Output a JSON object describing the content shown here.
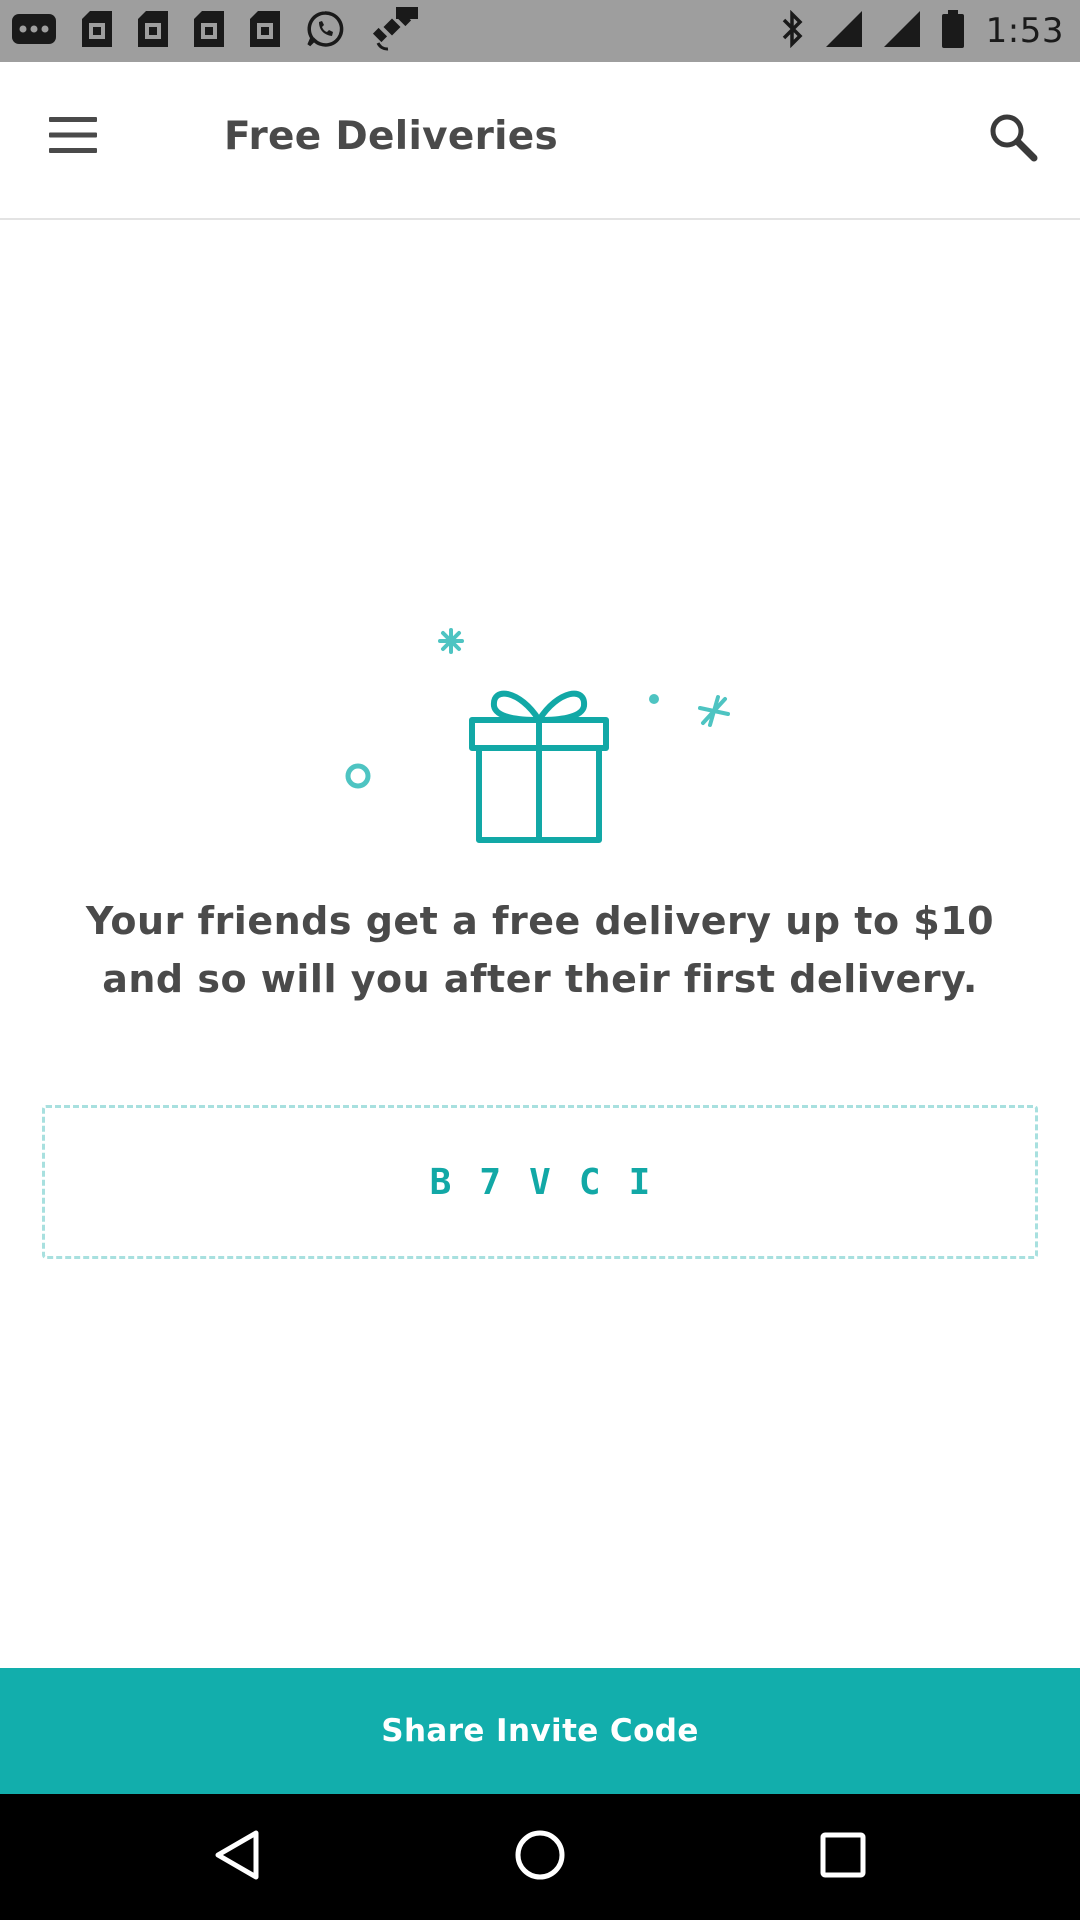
{
  "status_bar": {
    "time": "1:53",
    "left_icons": [
      "more-dots-icon",
      "sim-card-icon",
      "sim-card-icon",
      "sim-card-icon",
      "sim-card-icon",
      "whatsapp-icon",
      "satellite-fake-gps-icon"
    ],
    "right_icons": [
      "bluetooth-icon",
      "signal-icon",
      "signal-icon",
      "battery-icon"
    ]
  },
  "app_bar": {
    "title": "Free Deliveries",
    "menu_icon": "hamburger-menu-icon",
    "search_icon": "search-icon"
  },
  "illustration": {
    "icon": "gift-box-icon",
    "color": "#12a8a6"
  },
  "main": {
    "message": "Your friends get a free delivery up to $10 and so will you after their first delivery.",
    "invite_code": "B7VCI"
  },
  "share_button": {
    "label": "Share Invite Code",
    "color": "#12aeac"
  },
  "nav_bar": {
    "buttons": [
      "back-icon",
      "home-icon",
      "recents-icon"
    ]
  }
}
